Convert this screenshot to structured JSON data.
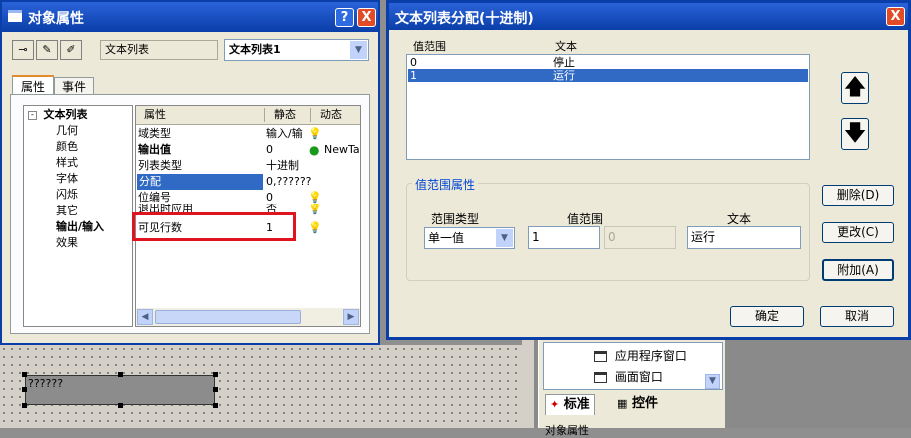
{
  "canvas": {
    "object_text": "??????",
    "panel": {
      "items": [
        "应用程序窗口",
        "画面窗口"
      ],
      "tabs": [
        "标准",
        "控件"
      ],
      "footer": "对象属性"
    }
  },
  "obj_props": {
    "title": "对象属性",
    "help_label": "?",
    "close_label": "X",
    "type_label": "文本列表",
    "object_name": "文本列表1",
    "tabs": [
      "属性",
      "事件"
    ],
    "tree": {
      "root": "文本列表",
      "children": [
        "几何",
        "颜色",
        "样式",
        "字体",
        "闪烁",
        "其它",
        "输出/输入",
        "效果"
      ]
    },
    "grid": {
      "headers": [
        "属性",
        "静态",
        "动态"
      ],
      "rows": [
        {
          "name": "域类型",
          "static": "输入/输",
          "dynamic": ""
        },
        {
          "name": "输出值",
          "static": "0",
          "dynamic": "NewTa"
        },
        {
          "name": "列表类型",
          "static": "十进制",
          "dynamic": ""
        },
        {
          "name": "分配",
          "static": "0,??????",
          "dynamic": ""
        },
        {
          "name": "位编号",
          "static": "0",
          "dynamic": ""
        },
        {
          "name": "退出时应用",
          "static": "否",
          "dynamic": ""
        },
        {
          "name": "可见行数",
          "static": "1",
          "dynamic": ""
        }
      ]
    }
  },
  "assign_dialog": {
    "title": "文本列表分配(十进制)",
    "close_label": "X",
    "list_headers": [
      "值范围",
      "文本"
    ],
    "list_rows": [
      {
        "range": "0",
        "text": "停止"
      },
      {
        "range": "1",
        "text": "运行"
      }
    ],
    "group_title": "值范围属性",
    "range_type_label": "范围类型",
    "range_type_value": "单一值",
    "value_range_label": "值范围",
    "value_from": "1",
    "value_to": "0",
    "text_label": "文本",
    "text_value": "运行",
    "buttons": {
      "delete": "删除(D)",
      "change": "更改(C)",
      "append": "附加(A)",
      "ok": "确定",
      "cancel": "取消"
    }
  },
  "colors": {
    "title_blue": "#0a3ea8",
    "selection": "#316ac5",
    "highlight_red": "#e0141e"
  }
}
